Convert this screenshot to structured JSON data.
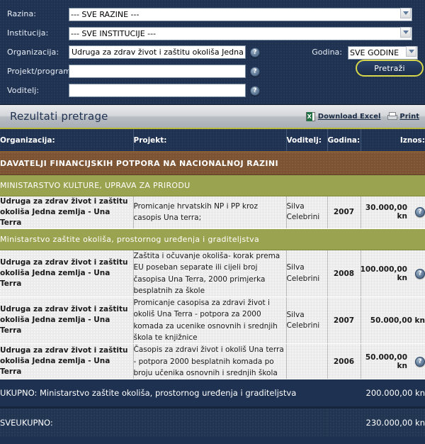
{
  "form": {
    "fields": [
      {
        "label": "Razina:",
        "type": "select",
        "value": "--- SVE RAZINE ---",
        "help": false
      },
      {
        "label": "Institucija:",
        "type": "select",
        "value": "--- SVE INSTITUCIJE ---",
        "help": false
      },
      {
        "label": "Organizacija:",
        "type": "input",
        "value": "Udruga za zdrav život i zaštitu okoliša Jedna zemlja",
        "placeholder": "",
        "help": true
      },
      {
        "label": "Projekt/program:",
        "type": "input",
        "value": "",
        "placeholder": "",
        "help": true
      },
      {
        "label": "Voditelj:",
        "type": "input",
        "value": "",
        "placeholder": "",
        "help": true
      }
    ],
    "godina_label": "Godina:",
    "godina_value": "SVE GODINE",
    "search_button": "Pretraži",
    "help_glyph": "?"
  },
  "results_bar": {
    "title": "Rezultati pretrage",
    "download_excel": "Download Excel",
    "print": "Print"
  },
  "table": {
    "headers": [
      "Organizacija:",
      "Projekt:",
      "Voditelj:",
      "Godina:",
      "Iznos:"
    ],
    "national_band": "DAVATELJI FINANCIJSKIH POTPORA NA NACIONALNOJ RAZINI",
    "sections": [
      {
        "ministry": "MINISTARSTVO KULTURE, UPRAVA ZA PRIRODU",
        "rows": [
          {
            "organizacija": "Udruga za zdrav život i zaštitu okoliša Jedna zemlja - Una Terra",
            "projekt": "Promicanje hrvatskih NP i PP kroz casopis Una terra;",
            "voditelj": "Silva Celebrini",
            "godina": "2007",
            "iznos": "30.000,00 kn",
            "help": true
          }
        ],
        "total_label": "",
        "total_amount": ""
      },
      {
        "ministry": "Ministarstvo zaštite okoliša, prostornog uređenja i graditeljstva",
        "rows": [
          {
            "organizacija": "Udruga za zdrav život i zaštitu okoliša Jedna zemlja - Una Terra",
            "projekt": "Zaštita i očuvanje okoliša- korak prema EU poseban separate ili cijeli broj časopisa Una Terra, 2000 primjerka besplatnih za škole",
            "voditelj": "Silva Celebrini",
            "godina": "2008",
            "iznos": "100.000,00 kn",
            "help": true
          },
          {
            "organizacija": "Udruga za zdrav život i zaštitu okoliša Jedna zemlja - Una Terra",
            "projekt": "Promicanje casopisa za zdravi život i okoliš Una Terra - potpora za 2000 komada za ucenike osnovnih i srednjih škola te knjižnice",
            "voditelj": "Silva Celebrini",
            "godina": "2007",
            "iznos": "50.000,00 kn",
            "help": false
          },
          {
            "organizacija": "Udruga za zdrav život i zaštitu okoliša Jedna zemlja - Una Terra",
            "projekt": "Časopis za zdravi život i okoliš Una terra - potpora 2000 besplatnih komada po broju učenika osnovnih i srednjih škola",
            "voditelj": "",
            "godina": "2006",
            "iznos": "50.000,00 kn",
            "help": true
          }
        ],
        "total_label": "UKUPNO: Ministarstvo zaštite okoliša, prostornog uređenja i graditeljstva",
        "total_amount": "200.000,00 kn"
      }
    ],
    "grand_total_label": "SVEUKUPNO:",
    "grand_total_amount": "230.000,00 kn"
  },
  "colors": {
    "panel_navy": "#1f3252",
    "band_brown": "#7d5433",
    "band_olive": "#9aa350",
    "total_blue": "#5c7596",
    "grand_navy": "#213552",
    "accent_yellow": "#d8d64a"
  }
}
